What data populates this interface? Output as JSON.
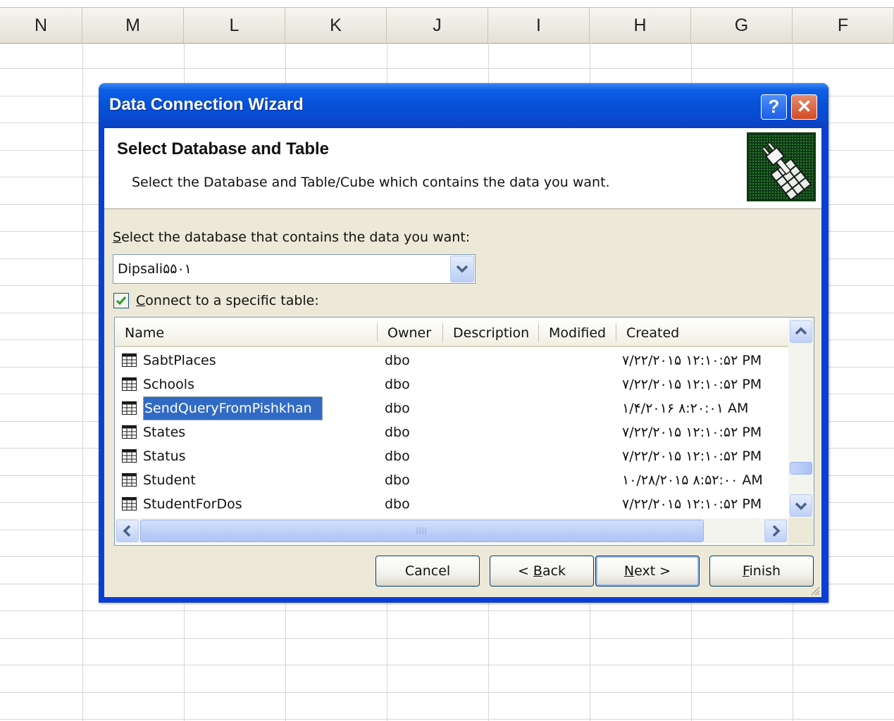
{
  "sheet": {
    "columns": [
      "N",
      "M",
      "L",
      "K",
      "J",
      "I",
      "H",
      "G",
      "F"
    ]
  },
  "dialog": {
    "title": "Data Connection Wizard",
    "help_label": "?",
    "close_label": "✕",
    "header": {
      "title": "Select Database and Table",
      "subtitle": "Select the Database and Table/Cube which contains the data you want."
    },
    "database_prompt_first": "S",
    "database_prompt_rest": "elect the database that contains the data you want:",
    "database_value": "Dipsali۵۵۰۱",
    "checkbox_checked": true,
    "checkbox_label_first": "C",
    "checkbox_label_rest": "onnect to a specific table:",
    "list": {
      "columns": [
        "Name",
        "Owner",
        "Description",
        "Modified",
        "Created"
      ],
      "rows": [
        {
          "name": "SabtPlaces",
          "owner": "dbo",
          "created": "۷/۲۲/۲۰۱۵ ۱۲:۱۰:۵۲ PM"
        },
        {
          "name": "Schools",
          "owner": "dbo",
          "created": "۷/۲۲/۲۰۱۵ ۱۲:۱۰:۵۲ PM"
        },
        {
          "name": "SendQueryFromPishkhan",
          "owner": "dbo",
          "created": "۱/۴/۲۰۱۶ ۸:۲۰:۰۱ AM",
          "selected": true
        },
        {
          "name": "States",
          "owner": "dbo",
          "created": "۷/۲۲/۲۰۱۵ ۱۲:۱۰:۵۲ PM"
        },
        {
          "name": "Status",
          "owner": "dbo",
          "created": "۷/۲۲/۲۰۱۵ ۱۲:۱۰:۵۲ PM"
        },
        {
          "name": "Student",
          "owner": "dbo",
          "created": "۱۰/۲۸/۲۰۱۵ ۸:۵۲:۰۰ AM"
        },
        {
          "name": "StudentForDos",
          "owner": "dbo",
          "created": "۷/۲۲/۲۰۱۵ ۱۲:۱۰:۵۲ PM"
        }
      ]
    },
    "buttons": {
      "cancel": "Cancel",
      "back_prefix": "< ",
      "back_key": "B",
      "back_rest": "ack",
      "next_key": "N",
      "next_rest": "ext >",
      "finish_key": "F",
      "finish_rest": "inish"
    },
    "icons": {
      "table_icon": "table-icon",
      "wizard_image": "plug-database-icon"
    }
  }
}
